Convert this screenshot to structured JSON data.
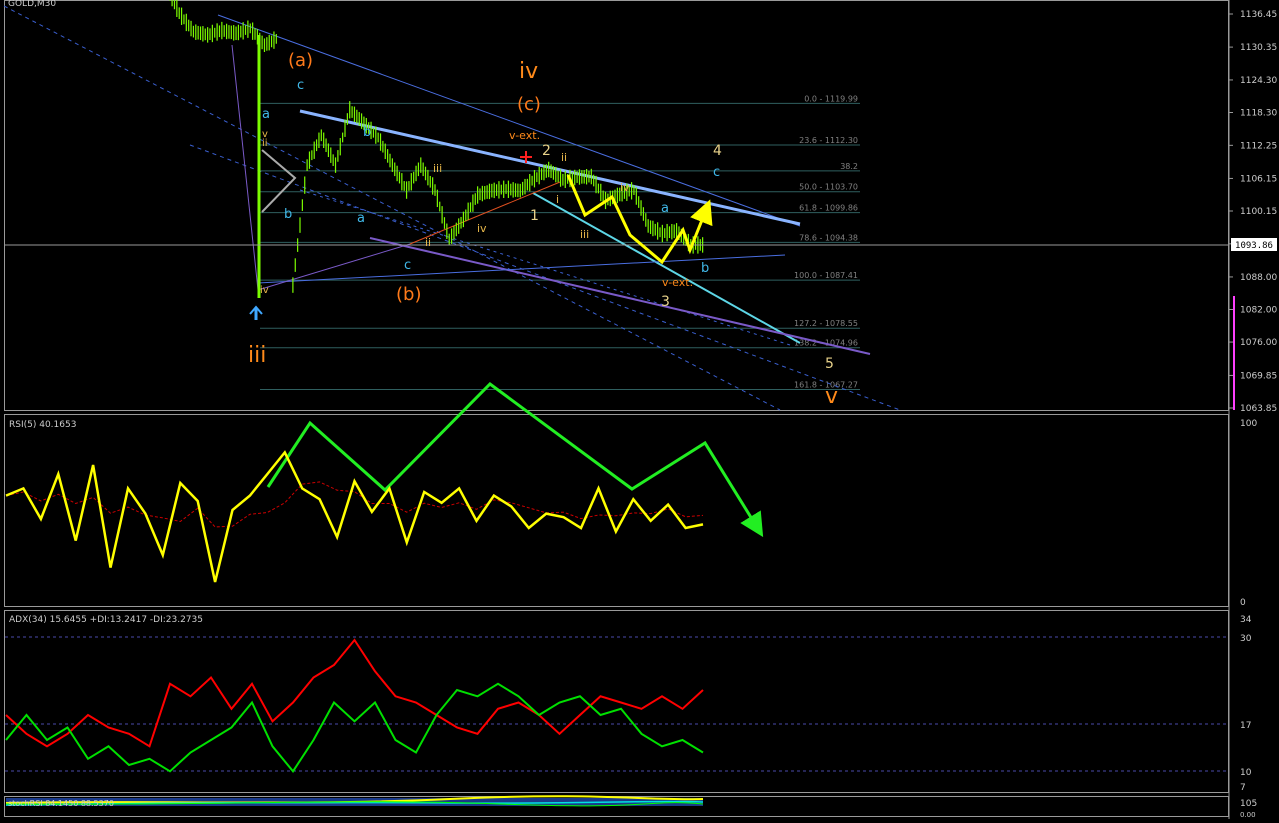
{
  "colors": {
    "background": "#000000",
    "frame": "#c0c0c0",
    "price_bars": "#7cfc00",
    "rsi": "#ffff00",
    "rsi_ma": "#cc0000",
    "adx_plus_di": "#00e000",
    "adx_minus_di": "#ff0000",
    "green_arrow": "#22ee22",
    "fib_line": "#2f5f5f",
    "channel_blue": "#4a6ee0",
    "channel_light": "#8ab4ff",
    "channel_cyan": "#5dd6e6",
    "channel_purple": "#7a5ac8",
    "wave_orange": "#ff7a1a",
    "wave_yellow": "#e8d28a",
    "wave_cyan": "#40b8e8",
    "yellow_path": "#ffff00"
  },
  "header": {
    "symbol_label": "GOLD,M30"
  },
  "price_axis": {
    "ticks": [
      "1136.45",
      "1130.35",
      "1124.30",
      "1118.30",
      "1112.25",
      "1106.15",
      "1100.15",
      "1094.10",
      "1088.00",
      "1082.00",
      "1076.00",
      "1069.85",
      "1063.85"
    ],
    "current_price": "1093.86"
  },
  "fib_levels": [
    {
      "label": "0.0 - 1119.99",
      "price": 1119.99
    },
    {
      "label": "23.6 - 1112.30",
      "price": 1112.3
    },
    {
      "label": "38.2",
      "price": 1107.55
    },
    {
      "label": "50.0 - 1103.70",
      "price": 1103.7
    },
    {
      "label": "61.8 - 1099.86",
      "price": 1099.86
    },
    {
      "label": "78.6 - 1094.38",
      "price": 1094.38
    },
    {
      "label": "100.0 - 1087.41",
      "price": 1087.41
    },
    {
      "label": "127.2 - 1078.55",
      "price": 1078.55
    },
    {
      "label": "138.2 - 1074.96",
      "price": 1074.96
    },
    {
      "label": "161.8 - 1067.27",
      "price": 1067.27
    }
  ],
  "wave_labels": {
    "a_paren": "(a)",
    "iv_big": "iv",
    "c_paren": "(c)",
    "b_paren": "(b)",
    "iii_big": "iii",
    "v_big": "v",
    "v_ext_top": "v-ext.",
    "v_ext_bottom": "v-ext.",
    "w2": "2",
    "w1": "1",
    "w3": "3",
    "w4": "4",
    "w5": "5",
    "c_top": "c",
    "a_left": "a",
    "v_small": "v",
    "ii_small": "ii",
    "b_left": "b",
    "a_mid": "a",
    "b_mid": "b",
    "c_low": "c",
    "iv_low": "iv",
    "iii_mid": "iii",
    "ii_mid": "ii",
    "iv_mid": "iv",
    "ii_right": "ii",
    "i_right": "i",
    "iii_right": "iii",
    "iv_right": "iv",
    "a_right": "a",
    "b_right": "b",
    "c_right": "c"
  },
  "rsi_panel": {
    "label": "RSI(5) 40.1653",
    "max": "100",
    "min": "0"
  },
  "adx_panel": {
    "label": "ADX(34) 15.6455 +DI:13.2417 -DI:23.2735",
    "ticks": [
      "34",
      "30",
      "17",
      "10",
      "7"
    ]
  },
  "stoch_panel": {
    "label": "stochRSI 84.1450 88.5370",
    "ticks": [
      "105",
      "0.00"
    ]
  },
  "chart_data": {
    "type": "line",
    "title": "GOLD,M30",
    "price_range": [
      1062.5,
      1138.5
    ],
    "current_price": 1093.86,
    "price_series": [
      {
        "x": 0,
        "y": 1142.0
      },
      {
        "x": 1,
        "y": 1136.6
      },
      {
        "x": 2,
        "y": 1133.2
      },
      {
        "x": 3,
        "y": 1132.6
      },
      {
        "x": 4,
        "y": 1133.4
      },
      {
        "x": 5,
        "y": 1132.9
      },
      {
        "x": 6,
        "y": 1133.8
      },
      {
        "x": 7,
        "y": 1130.7
      },
      {
        "x": 8,
        "y": 1132.1
      },
      {
        "x": 9,
        "y": 1086.5
      },
      {
        "x": 10,
        "y": 1108.6
      },
      {
        "x": 11,
        "y": 1114.1
      },
      {
        "x": 12,
        "y": 1108.6
      },
      {
        "x": 13,
        "y": 1118.8
      },
      {
        "x": 14,
        "y": 1116.3
      },
      {
        "x": 15,
        "y": 1113.7
      },
      {
        "x": 16,
        "y": 1108.6
      },
      {
        "x": 17,
        "y": 1104.0
      },
      {
        "x": 18,
        "y": 1108.6
      },
      {
        "x": 19,
        "y": 1104.0
      },
      {
        "x": 20,
        "y": 1094.9
      },
      {
        "x": 21,
        "y": 1098.6
      },
      {
        "x": 22,
        "y": 1103.1
      },
      {
        "x": 23,
        "y": 1103.9
      },
      {
        "x": 24,
        "y": 1104.2
      },
      {
        "x": 25,
        "y": 1103.9
      },
      {
        "x": 26,
        "y": 1106.1
      },
      {
        "x": 27,
        "y": 1107.8
      },
      {
        "x": 28,
        "y": 1105.9
      },
      {
        "x": 29,
        "y": 1106.4
      },
      {
        "x": 30,
        "y": 1106.5
      },
      {
        "x": 31,
        "y": 1102.1
      },
      {
        "x": 32,
        "y": 1103.2
      },
      {
        "x": 33,
        "y": 1104.0
      },
      {
        "x": 34,
        "y": 1097.4
      },
      {
        "x": 35,
        "y": 1096.0
      },
      {
        "x": 36,
        "y": 1096.5
      },
      {
        "x": 37,
        "y": 1093.9
      },
      {
        "x": 38,
        "y": 1093.9
      }
    ],
    "rsi": {
      "name": "RSI(5)",
      "last": 40.1653,
      "range": [
        0,
        100
      ],
      "values": [
        58,
        62,
        45,
        70,
        33,
        75,
        18,
        62,
        48,
        25,
        65,
        55,
        10,
        50,
        58,
        70,
        82,
        62,
        56,
        35,
        66,
        49,
        62,
        32,
        60,
        54,
        62,
        44,
        58,
        52,
        40,
        48,
        46,
        40,
        62,
        38,
        56,
        44,
        53,
        40,
        42
      ]
    },
    "adx": {
      "name": "ADX(34)",
      "adx": 15.6455,
      "plus_di": 13.2417,
      "minus_di": 23.2735,
      "range": [
        7,
        35
      ],
      "plus_di_values": [
        15,
        19,
        15,
        17,
        12,
        14,
        11,
        12,
        10,
        13,
        15,
        17,
        21,
        14,
        10,
        15,
        21,
        18,
        21,
        15,
        13,
        19,
        23,
        22,
        24,
        22,
        19,
        21,
        22,
        19,
        20,
        16,
        14,
        15,
        13
      ],
      "minus_di_values": [
        19,
        16,
        14,
        16,
        19,
        17,
        16,
        14,
        24,
        22,
        25,
        20,
        24,
        18,
        21,
        25,
        27,
        31,
        26,
        22,
        21,
        19,
        17,
        16,
        20,
        21,
        19,
        16,
        19,
        22,
        21,
        20,
        22,
        20,
        23
      ]
    },
    "stoch_rsi": {
      "name": "stochRSI",
      "k": 84.145,
      "d": 88.537
    }
  }
}
